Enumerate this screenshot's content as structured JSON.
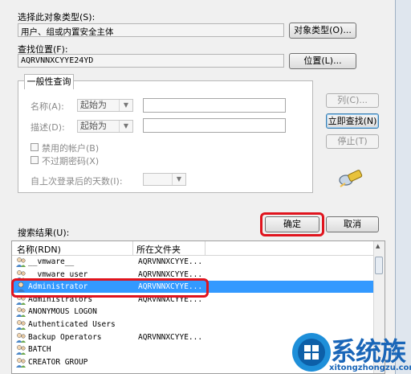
{
  "dialog": {
    "object_type_label": "选择此对象类型(S):",
    "object_type_value": "用户、组或内置安全主体",
    "object_type_button": "对象类型(O)...",
    "location_label": "查找位置(F):",
    "location_value": "AQRVNNXCYYE24YD",
    "location_button": "位置(L)..."
  },
  "query": {
    "tab_label": "一般性查询",
    "name_label": "名称(A):",
    "name_mode": "起始为",
    "desc_label": "描述(D):",
    "desc_mode": "起始为",
    "disabled_accounts": "禁用的帐户(B)",
    "non_expiring_pw": "不过期密码(X)",
    "days_label": "自上次登录后的天数(I):",
    "columns_button": "列(C)...",
    "find_now_button": "立即查找(N)",
    "stop_button": "停止(T)"
  },
  "actions": {
    "ok_button": "确定",
    "cancel_button": "取消"
  },
  "results": {
    "label": "搜索结果(U):",
    "col_name": "名称(RDN)",
    "col_folder": "所在文件夹",
    "rows": [
      {
        "name": "__vmware__",
        "folder": "AQRVNNXCYYE..."
      },
      {
        "name": "__vmware_user__",
        "folder": "AQRVNNXCYYE..."
      },
      {
        "name": "Administrator",
        "folder": "AQRVNNXCYYE..."
      },
      {
        "name": "Administrators",
        "folder": "AQRVNNXCYYE..."
      },
      {
        "name": "ANONYMOUS LOGON",
        "folder": ""
      },
      {
        "name": "Authenticated Users",
        "folder": ""
      },
      {
        "name": "Backup Operators",
        "folder": "AQRVNNXCYYE..."
      },
      {
        "name": "BATCH",
        "folder": ""
      },
      {
        "name": "CREATOR GROUP",
        "folder": ""
      }
    ]
  },
  "watermark": {
    "brand": "系统族",
    "url": "xitongzhongzu.com"
  }
}
